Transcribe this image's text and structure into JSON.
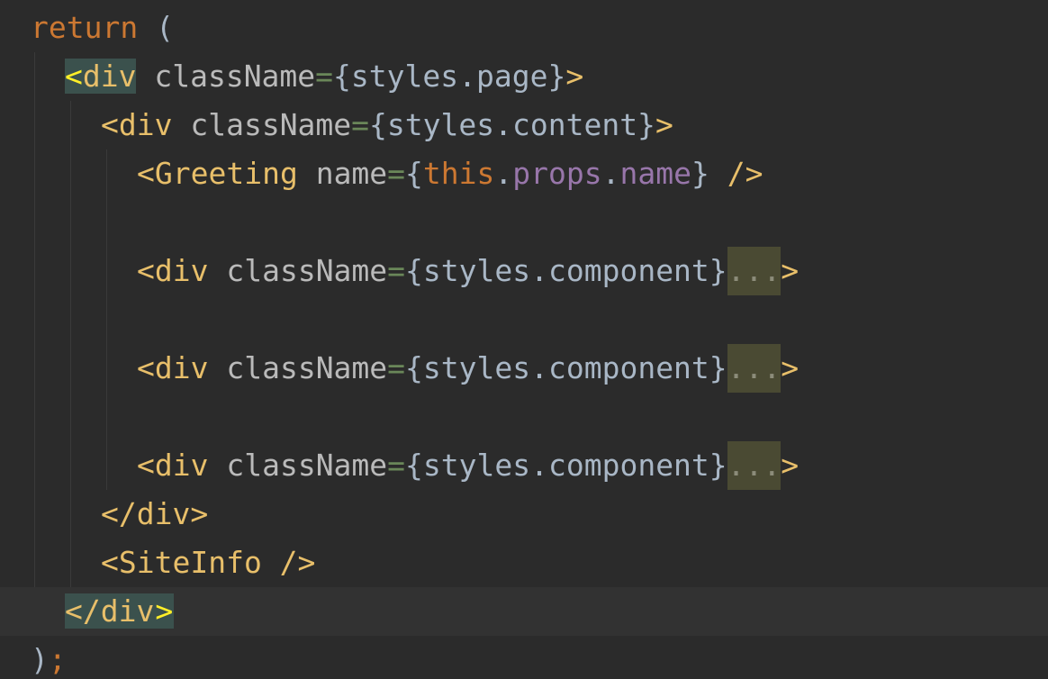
{
  "code": {
    "l1_return": "return",
    "l1_paren": " (",
    "l2_open": "<",
    "l2_tag": "div",
    "l2_attr": " className",
    "l2_eq": "=",
    "l2_expr": "{styles.page}",
    "l2_close": ">",
    "l3_open": "<",
    "l3_tag": "div",
    "l3_attr": " className",
    "l3_eq": "=",
    "l3_expr": "{styles.content}",
    "l3_close": ">",
    "l4_open": "<",
    "l4_tag": "Greeting",
    "l4_attr": " name",
    "l4_eq": "=",
    "l4_brace_open": "{",
    "l4_this": "this",
    "l4_dot1": ".",
    "l4_props": "props",
    "l4_dot2": ".",
    "l4_name": "name",
    "l4_brace_close": "}",
    "l4_selfclose": " />",
    "l6_open": "<",
    "l6_tag": "div",
    "l6_attr": " className",
    "l6_eq": "=",
    "l6_expr": "{styles.component}",
    "l6_fold": "...",
    "l6_close": ">",
    "l8_open": "<",
    "l8_tag": "div",
    "l8_attr": " className",
    "l8_eq": "=",
    "l8_expr": "{styles.component}",
    "l8_fold": "...",
    "l8_close": ">",
    "l10_open": "<",
    "l10_tag": "div",
    "l10_attr": " className",
    "l10_eq": "=",
    "l10_expr": "{styles.component}",
    "l10_fold": "...",
    "l10_close": ">",
    "l11_close_tag": "</div>",
    "l12_tag": "<SiteInfo />",
    "l13_open": "</div",
    "l13_close": ">",
    "l14_paren": ")",
    "l14_semi": ";"
  }
}
